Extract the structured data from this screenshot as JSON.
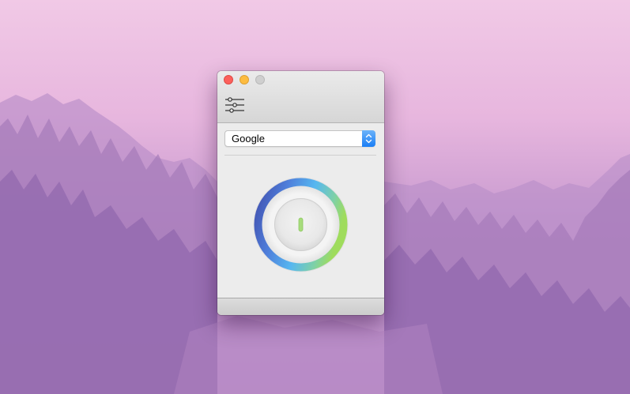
{
  "window": {
    "controls": [
      "close",
      "minimize",
      "zoom"
    ]
  },
  "toolbar": {
    "settings_icon": "sliders-icon"
  },
  "engine_select": {
    "selected": "Google"
  },
  "power_dial": {
    "state": "off",
    "icon": "power-toggle-icon"
  },
  "colors": {
    "close": "#fc605c",
    "minimize": "#fdbc40",
    "zoom": "#cfcfcf",
    "accent_blue": "#1b7ef5",
    "ring_start": "#3f47a6",
    "ring_mid": "#56b7f0",
    "ring_end": "#9fdc5c"
  }
}
